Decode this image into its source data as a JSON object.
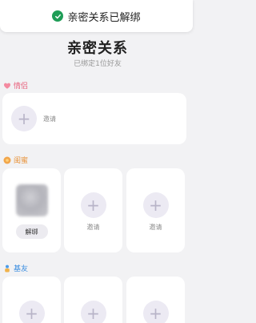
{
  "toast": {
    "text": "亲密关系已解绑",
    "icon": "check-circle-icon",
    "icon_color": "#1f9d57"
  },
  "header": {
    "title": "亲密关系",
    "subtitle": "已绑定1位好友"
  },
  "sections": {
    "lover": {
      "label": "情侣",
      "color": "#e8607b",
      "icon": "heart-icon",
      "invite_label": "邀请"
    },
    "bestie": {
      "label": "闺蜜",
      "color": "#e8933a",
      "icon": "flower-icon",
      "slots": [
        {
          "type": "friend",
          "button_label": "解绑"
        },
        {
          "type": "invite",
          "label": "邀请"
        },
        {
          "type": "invite",
          "label": "邀请"
        }
      ]
    },
    "buddy": {
      "label": "基友",
      "color": "#3b8ee0",
      "icon": "figure-icon"
    }
  },
  "colors": {
    "background": "#f2f2f4",
    "card": "#ffffff",
    "plus_bg": "#eceaf3",
    "plus_fg": "#b8b4c8"
  }
}
